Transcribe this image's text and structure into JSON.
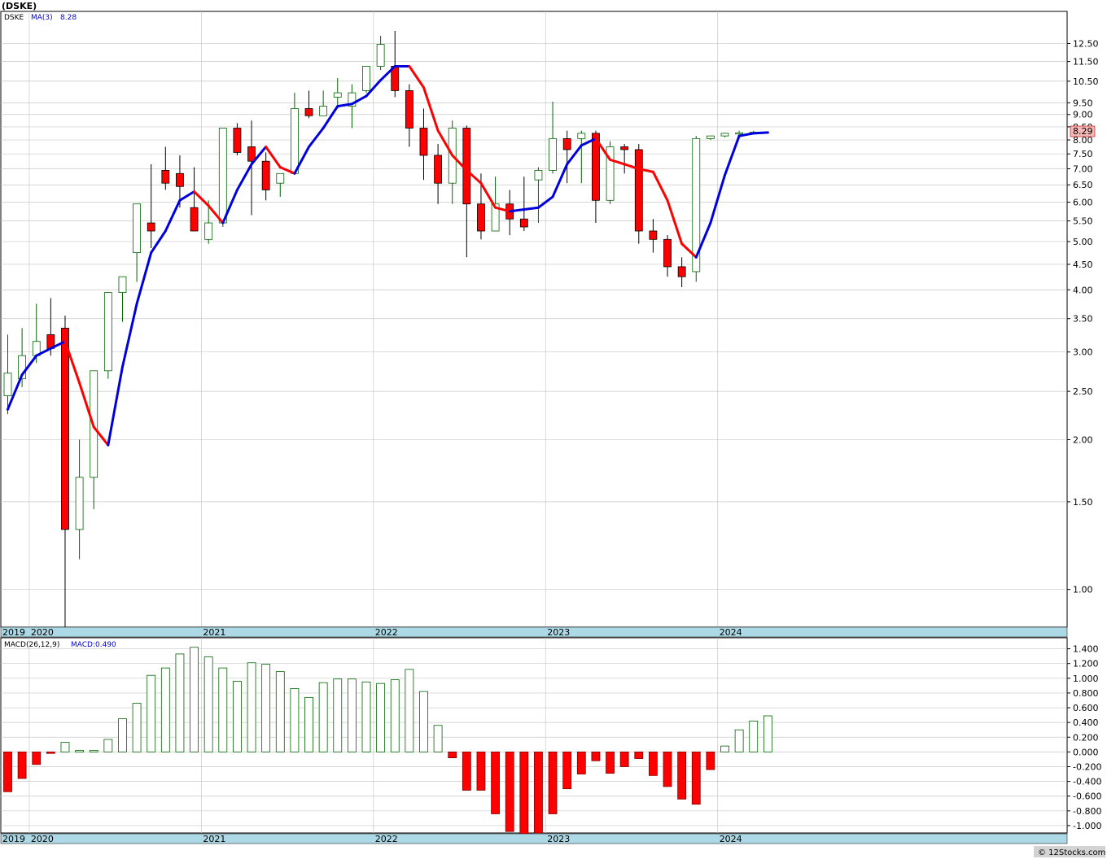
{
  "symbol_title": "(DSKE)",
  "copyright": "© 12Stocks.com",
  "colors": {
    "up_candle_stroke": "#006400",
    "down_candle_fill": "#ff0000",
    "ma_up": "#0000dd",
    "ma_down": "#ff0000",
    "axis_band": "#add8e6",
    "grid": "#c8c8c8",
    "last_price_box": "#f4b8b8"
  },
  "price_panel": {
    "legend_symbol": "DSKE",
    "legend_ma": "MA(3)",
    "legend_ma_value": "8.28",
    "last_price_label": "8.29",
    "y_scale": "log",
    "ylim": [
      0.84,
      14.5
    ],
    "y_ticks": [
      "12.50",
      "11.50",
      "10.50",
      "9.50",
      "9.00",
      "8.50",
      "8.00",
      "7.50",
      "7.00",
      "6.50",
      "6.00",
      "5.50",
      "5.00",
      "4.50",
      "4.00",
      "3.50",
      "3.00",
      "2.50",
      "2.00",
      "1.50",
      "1.00"
    ]
  },
  "macd_panel": {
    "legend_label": "MACD(26,12,9)",
    "legend_value": "MACD:0.490",
    "ylim": [
      -1.1,
      1.55
    ],
    "y_ticks": [
      "1.400",
      "1.200",
      "1.000",
      "0.800",
      "0.600",
      "0.400",
      "0.200",
      "0.000",
      "-0.200",
      "-0.400",
      "-0.600",
      "-0.800",
      "-1.000"
    ]
  },
  "x_axis_years": [
    "2019",
    "2020",
    "2021",
    "2022",
    "2023",
    "2024"
  ],
  "chart_data": [
    {
      "type": "candlestick",
      "title": "(DSKE)",
      "interval": "monthly",
      "x_categories": [
        "2019-11",
        "2019-12",
        "2020-01",
        "2020-02",
        "2020-03",
        "2020-04",
        "2020-05",
        "2020-06",
        "2020-07",
        "2020-08",
        "2020-09",
        "2020-10",
        "2020-11",
        "2020-12",
        "2021-01",
        "2021-02",
        "2021-03",
        "2021-04",
        "2021-05",
        "2021-06",
        "2021-07",
        "2021-08",
        "2021-09",
        "2021-10",
        "2021-11",
        "2021-12",
        "2022-01",
        "2022-02",
        "2022-03",
        "2022-04",
        "2022-05",
        "2022-06",
        "2022-07",
        "2022-08",
        "2022-09",
        "2022-10",
        "2022-11",
        "2022-12",
        "2023-01",
        "2023-02",
        "2023-03",
        "2023-04",
        "2023-05",
        "2023-06",
        "2023-07",
        "2023-08",
        "2023-09",
        "2023-10",
        "2023-11",
        "2023-12",
        "2024-01",
        "2024-02",
        "2024-03"
      ],
      "open": [
        2.45,
        2.65,
        2.95,
        3.25,
        3.35,
        1.32,
        1.68,
        2.75,
        3.95,
        4.75,
        5.45,
        6.95,
        6.85,
        5.85,
        5.05,
        5.45,
        8.45,
        7.75,
        7.25,
        6.55,
        6.85,
        9.25,
        8.95,
        9.75,
        9.35,
        10.05,
        11.25,
        11.25,
        10.05,
        8.45,
        7.45,
        6.55,
        8.45,
        5.95,
        5.25,
        5.95,
        5.55,
        6.65,
        6.95,
        8.05,
        8.05,
        8.25,
        6.05,
        7.75,
        7.65,
        5.25,
        5.05,
        4.45,
        4.35,
        8.05,
        8.15,
        8.25,
        8.27
      ],
      "close": [
        2.72,
        2.95,
        3.15,
        3.05,
        1.32,
        1.68,
        2.75,
        3.95,
        4.25,
        5.95,
        5.25,
        6.55,
        6.45,
        5.25,
        5.45,
        8.45,
        7.55,
        7.25,
        6.35,
        6.85,
        9.25,
        8.95,
        9.35,
        9.95,
        9.95,
        11.25,
        12.45,
        10.05,
        8.45,
        7.45,
        6.55,
        8.45,
        5.95,
        5.25,
        5.95,
        5.55,
        5.35,
        6.95,
        8.05,
        7.65,
        8.25,
        6.05,
        7.75,
        7.65,
        5.25,
        5.05,
        4.45,
        4.25,
        8.05,
        8.15,
        8.25,
        8.27,
        8.29
      ],
      "high": [
        3.25,
        3.35,
        3.75,
        3.85,
        3.55,
        2.0,
        2.0,
        3.35,
        3.95,
        4.85,
        7.15,
        7.75,
        7.45,
        7.05,
        6.05,
        5.75,
        8.65,
        8.75,
        7.55,
        6.85,
        9.95,
        10.05,
        10.05,
        10.65,
        10.35,
        10.95,
        12.95,
        13.25,
        10.35,
        9.25,
        7.85,
        8.75,
        8.55,
        6.85,
        6.75,
        6.35,
        6.75,
        7.05,
        9.55,
        8.35,
        8.35,
        8.35,
        7.95,
        7.85,
        7.85,
        5.55,
        5.15,
        4.65,
        8.15,
        8.15,
        8.27,
        8.35,
        8.35
      ],
      "low": [
        2.25,
        2.55,
        2.85,
        2.95,
        0.84,
        1.15,
        1.45,
        2.65,
        3.45,
        4.15,
        4.85,
        6.35,
        5.85,
        5.25,
        4.95,
        5.35,
        7.45,
        5.65,
        6.05,
        6.15,
        6.85,
        8.85,
        8.95,
        9.25,
        8.45,
        9.95,
        11.05,
        9.75,
        7.75,
        6.65,
        5.95,
        5.95,
        4.65,
        5.05,
        5.25,
        5.15,
        5.25,
        5.45,
        6.85,
        6.55,
        6.55,
        5.45,
        5.95,
        6.85,
        4.95,
        4.75,
        4.25,
        4.05,
        4.15,
        8.0,
        8.1,
        8.2,
        8.25
      ],
      "ma3_name": "MA(3)",
      "ma3": [
        2.3,
        2.7,
        2.95,
        3.05,
        3.15,
        2.6,
        2.12,
        1.95,
        2.8,
        3.75,
        4.75,
        5.25,
        6.05,
        6.3,
        5.9,
        5.45,
        6.35,
        7.15,
        7.75,
        7.05,
        6.85,
        7.75,
        8.45,
        9.35,
        9.45,
        9.8,
        10.55,
        11.25,
        11.25,
        10.2,
        8.35,
        7.45,
        6.95,
        6.55,
        5.85,
        5.75,
        5.8,
        5.85,
        6.15,
        7.15,
        7.8,
        8.05,
        7.3,
        7.15,
        7.0,
        6.9,
        6.05,
        4.95,
        4.65,
        5.45,
        6.8,
        8.15,
        8.25,
        8.28
      ]
    },
    {
      "type": "bar",
      "title": "MACD(26,12,9)",
      "x_categories": [
        "2019-11",
        "2019-12",
        "2020-01",
        "2020-02",
        "2020-03",
        "2020-04",
        "2020-05",
        "2020-06",
        "2020-07",
        "2020-08",
        "2020-09",
        "2020-10",
        "2020-11",
        "2020-12",
        "2021-01",
        "2021-02",
        "2021-03",
        "2021-04",
        "2021-05",
        "2021-06",
        "2021-07",
        "2021-08",
        "2021-09",
        "2021-10",
        "2021-11",
        "2021-12",
        "2022-01",
        "2022-02",
        "2022-03",
        "2022-04",
        "2022-05",
        "2022-06",
        "2022-07",
        "2022-08",
        "2022-09",
        "2022-10",
        "2022-11",
        "2022-12",
        "2023-01",
        "2023-02",
        "2023-03",
        "2023-04",
        "2023-05",
        "2023-06",
        "2023-07",
        "2023-08",
        "2023-09",
        "2023-10",
        "2023-11",
        "2023-12",
        "2024-01",
        "2024-02",
        "2024-03"
      ],
      "values": [
        -0.54,
        -0.36,
        -0.17,
        -0.02,
        0.13,
        0.02,
        0.02,
        0.17,
        0.45,
        0.66,
        1.04,
        1.14,
        1.33,
        1.42,
        1.29,
        1.14,
        0.96,
        1.21,
        1.19,
        1.09,
        0.86,
        0.74,
        0.94,
        0.99,
        0.99,
        0.95,
        0.93,
        0.98,
        1.12,
        0.82,
        0.36,
        -0.08,
        -0.52,
        -0.52,
        -0.84,
        -1.08,
        -1.12,
        -1.1,
        -0.84,
        -0.5,
        -0.3,
        -0.12,
        -0.29,
        -0.2,
        -0.09,
        -0.32,
        -0.47,
        -0.64,
        -0.71,
        -0.24,
        0.08,
        0.3,
        0.42,
        0.49
      ]
    }
  ]
}
